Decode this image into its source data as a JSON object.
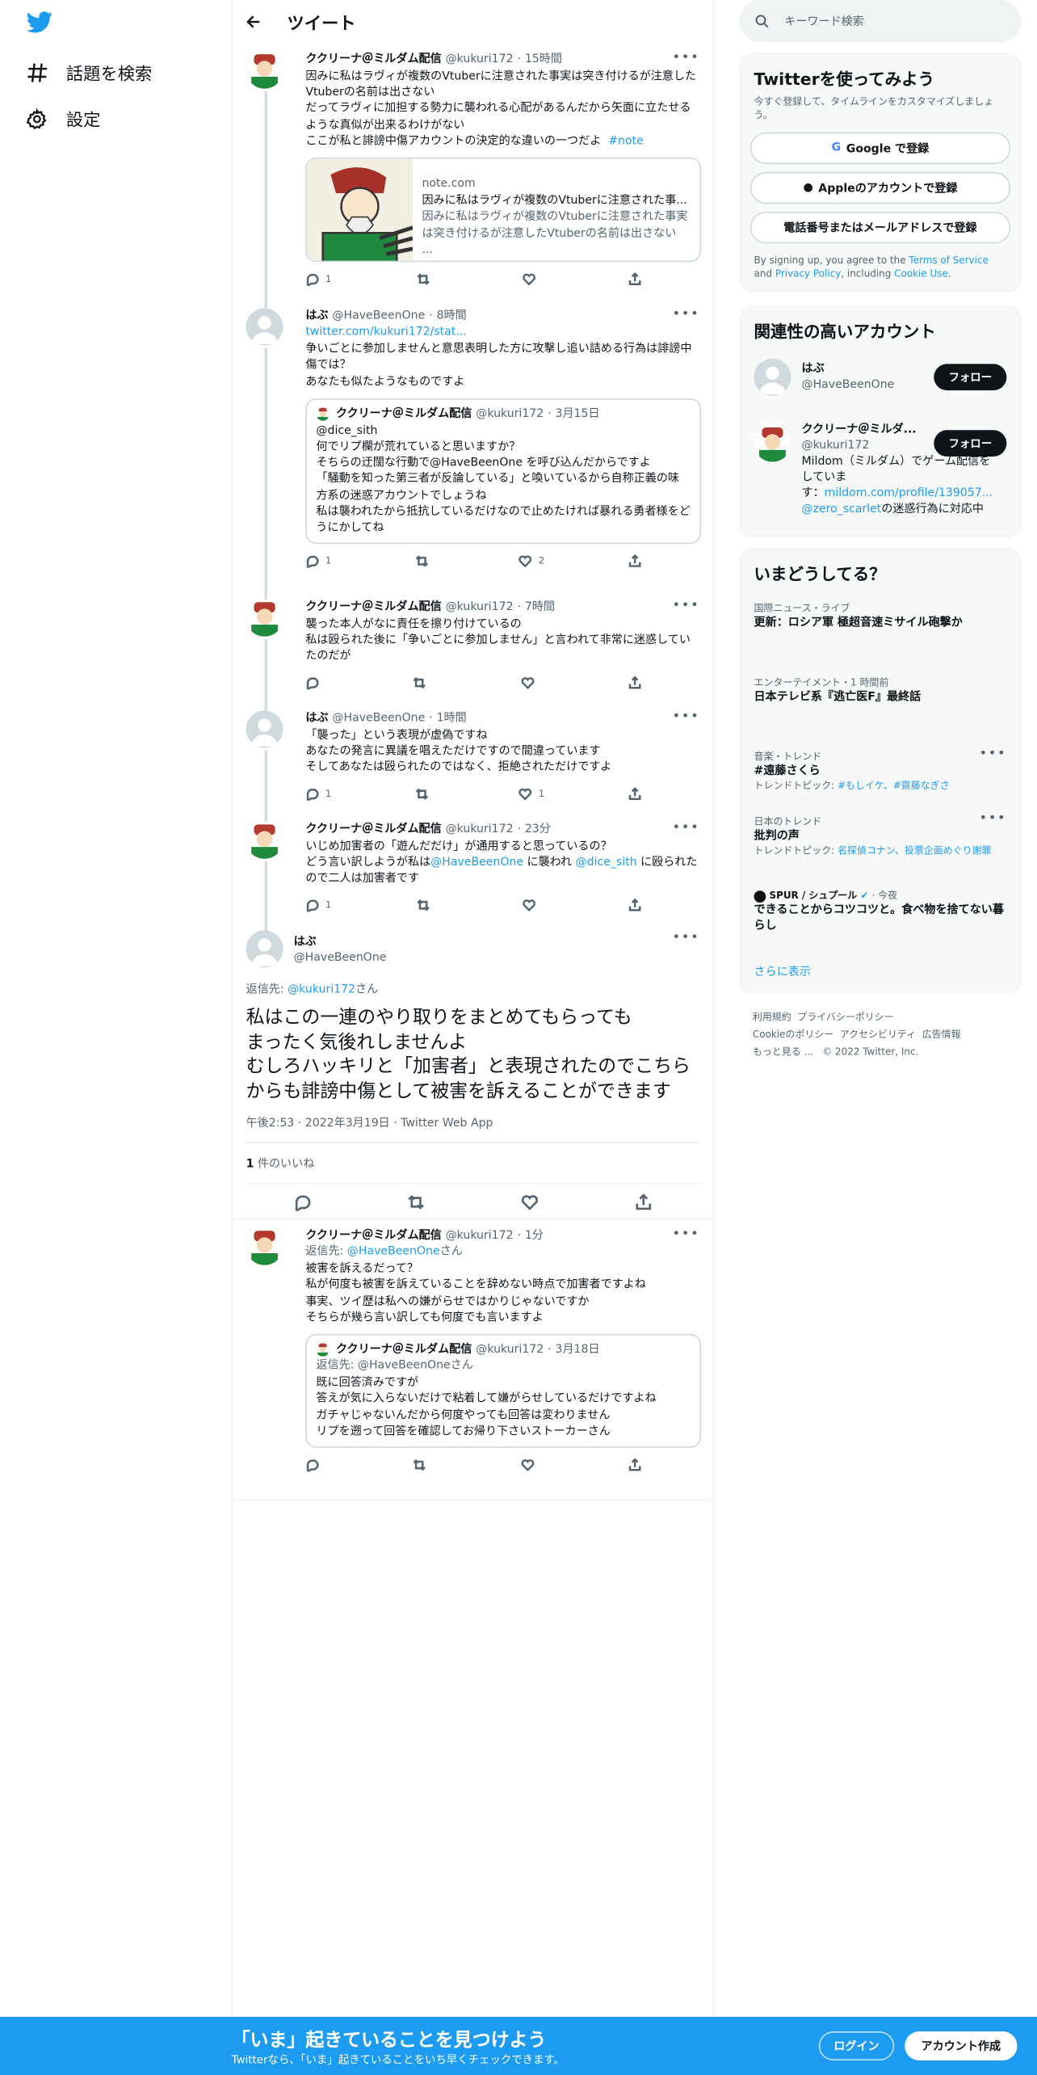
{
  "left": {
    "nav_explore": "話題を検索",
    "nav_settings": "設定"
  },
  "header": {
    "title": "ツイート"
  },
  "tweets": [
    {
      "name": "ククリーナ＠ミルダム配信",
      "handle": "@kukuri172",
      "time": "15時間",
      "body": "因みに私はラヴィが複数のVtuberに注意された事実は突き付けるが注意したVtuberの名前は出さない\nだってラヴィに加担する勢力に襲われる心配があるんだから矢面に立たせるような真似が出来るわけがない\nここが私と誹謗中傷アカウントの決定的な違いの一つだよ",
      "hashtag": "#note",
      "card_domain": "note.com",
      "card_title": "因みに私はラヴィが複数のVtuberに注意された事...",
      "card_desc": "因みに私はラヴィが複数のVtuberに注意された事実は突き付けるが注意したVtuberの名前は出さない ...",
      "replies": "1",
      "retweets": "",
      "likes": ""
    },
    {
      "name": "はぶ",
      "handle": "@HaveBeenOne",
      "time": "8時間",
      "link": "twitter.com/kukuri172/stat...",
      "body": "争いごとに参加しませんと意思表明した方に攻撃し追い詰める行為は誹謗中傷では？\nあなたも似たようなものですよ",
      "quote_name": "ククリーナ＠ミルダム配信",
      "quote_handle": "@kukuri172",
      "quote_time": "3月15日",
      "quote_body": "@dice_sith\n何でリプ欄が荒れていると思いますか？\nそちらの迂闊な行動で@HaveBeenOne を呼び込んだからですよ\n「騒動を知った第三者が反論している」と喚いているから自称正義の味方系の迷惑アカウントでしょうね\n私は襲われたから抵抗しているだけなので止めたければ暴れる勇者様をどうにかしてね",
      "replies": "1",
      "retweets": "",
      "likes": "2"
    },
    {
      "name": "ククリーナ＠ミルダム配信",
      "handle": "@kukuri172",
      "time": "7時間",
      "body": "襲った本人がなに責任を擦り付けているの\n私は殴られた後に「争いごとに参加しません」と言われて非常に迷惑していたのだが",
      "replies": "",
      "retweets": "",
      "likes": ""
    },
    {
      "name": "はぶ",
      "handle": "@HaveBeenOne",
      "time": "1時間",
      "body": "「襲った」という表現が虚偽ですね\nあなたの発言に異議を唱えただけですので間違っています\nそしてあなたは殴られたのではなく、拒絶されただけですよ",
      "replies": "1",
      "retweets": "",
      "likes": "1"
    },
    {
      "name": "ククリーナ＠ミルダム配信",
      "handle": "@kukuri172",
      "time": "23分",
      "body_a": "いじめ加害者の「遊んだだけ」が通用すると思っているの？\nどう言い訳しようが私は",
      "mention1": "@HaveBeenOne",
      "body_b": " に襲われ ",
      "mention2": "@dice_sith",
      "body_c": " に殴られたので二人は加害者です",
      "replies": "1",
      "retweets": "",
      "likes": ""
    }
  ],
  "main": {
    "name": "はぶ",
    "handle": "@HaveBeenOne",
    "reply_to_prefix": "返信先: ",
    "reply_to": "@kukuri172",
    "reply_to_suffix": "さん",
    "body": "私はこの一連のやり取りをまとめてもらっても\nまったく気後れしませんよ\nむしろハッキリと「加害者」と表現されたのでこちらからも誹謗中傷として被害を訴えることができます",
    "timestamp": "午後2:53 · 2022年3月19日 · Twitter Web App",
    "likes_count": "1",
    "likes_label": " 件のいいね"
  },
  "reply": {
    "name": "ククリーナ＠ミルダム配信",
    "handle": "@kukuri172",
    "time": "1分",
    "reply_to_prefix": "返信先: ",
    "reply_to": "@HaveBeenOne",
    "reply_to_suffix": "さん",
    "body": "被害を訴えるだって？\n私が何度も被害を訴えていることを辞めない時点で加害者ですよね\n事実、ツイ歴は私への嫌がらせではかりじゃないですか\nそちらが幾ら言い訳しても何度でも言いますよ",
    "quote_name": "ククリーナ＠ミルダム配信",
    "quote_handle": "@kukuri172",
    "quote_time": "3月18日",
    "quote_reply": "返信先: @HaveBeenOneさん",
    "quote_body": "既に回答済みですが\n答えが気に入らないだけで粘着して嫌がらせしているだけですよね\nガチャじゃないんだから何度やっても回答は変わりません\nリプを遡って回答を確認してお帰り下さいストーカーさん"
  },
  "right": {
    "search_placeholder": "キーワード検索",
    "signup_title": "Twitterを使ってみよう",
    "signup_sub": "今すぐ登録して、タイムラインをカスタマイズしましょう。",
    "google_btn": "Google で登録",
    "apple_btn": "Appleのアカウントで登録",
    "phone_btn": "電話番号またはメールアドレスで登録",
    "terms_a": "By signing up, you agree to the ",
    "terms_link1": "Terms of Service",
    "terms_b": " and ",
    "terms_link2": "Privacy Policy",
    "terms_c": ", including ",
    "terms_link3": "Cookie Use",
    "terms_d": ".",
    "related_title": "関連性の高いアカウント",
    "acc1_name": "はぶ",
    "acc1_handle": "@HaveBeenOne",
    "follow": "フォロー",
    "acc2_name": "ククリーナ＠ミルダ...",
    "acc2_handle": "@kukuri172",
    "acc2_bio_a": "Mildom（ミルダム）でゲーム配信をしていま\nす：",
    "acc2_bio_link": "mildom.com/profile/139057...",
    "acc2_bio_link2": "@zero_scarlet",
    "acc2_bio_b": "の迷惑行為に対応中",
    "trends_title": "いまどうしてる？",
    "t1_cat": "国際ニュース・ライブ",
    "t1_title": "更新：ロシア軍 極超音速ミサイル砲撃か",
    "t2_cat": "エンターテイメント・1 時間前",
    "t2_title": "日本テレビ系『逃亡医F』最終話",
    "t3_cat": "音楽・トレンド",
    "t3_title": "#遠藤さくら",
    "t3_topics_label": "トレンドトピック: ",
    "t3_topics": "#もしイケ、#齋藤なぎさ",
    "t4_cat": "日本のトレンド",
    "t4_title": "批判の声",
    "t4_topics_label": "トレンドトピック: ",
    "t4_topics": "名探偵コナン、投票企画めぐり謝罪",
    "t5_src": "SPUR / シュプール",
    "t5_time": "· 今夜",
    "t5_title": "できることからコツコツと。食べ物を捨てない暮らし",
    "more": "さらに表示",
    "footer": [
      "利用規約",
      "プライバシーポリシー",
      "Cookieのポリシー",
      "アクセシビリティ",
      "広告情報",
      "もっと見る ...",
      "© 2022 Twitter, Inc."
    ]
  },
  "bottom": {
    "title": "「いま」起きていることを見つけよう",
    "sub": "Twitterなら、「いま」起きていることをいち早くチェックできます。",
    "login": "ログイン",
    "signup": "アカウント作成"
  },
  "colors": {
    "accent": "#1d9bf0",
    "text": "#0f1419",
    "secondary": "#536471"
  }
}
